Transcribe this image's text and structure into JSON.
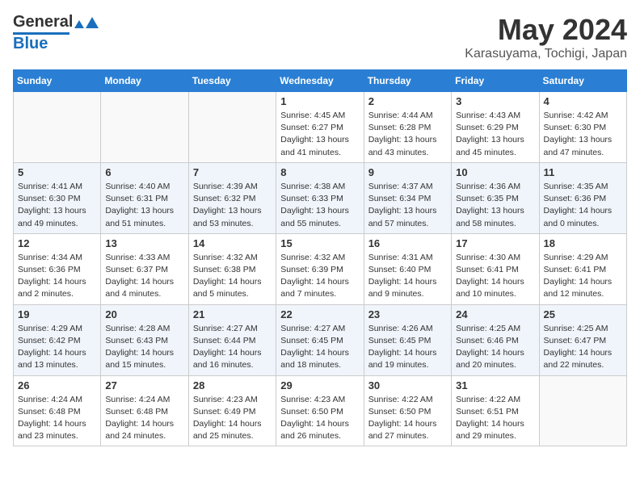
{
  "header": {
    "logo_general": "General",
    "logo_blue": "Blue",
    "month_year": "May 2024",
    "location": "Karasuyama, Tochigi, Japan"
  },
  "days_of_week": [
    "Sunday",
    "Monday",
    "Tuesday",
    "Wednesday",
    "Thursday",
    "Friday",
    "Saturday"
  ],
  "weeks": [
    [
      {
        "day": "",
        "sunrise": "",
        "sunset": "",
        "daylight": ""
      },
      {
        "day": "",
        "sunrise": "",
        "sunset": "",
        "daylight": ""
      },
      {
        "day": "",
        "sunrise": "",
        "sunset": "",
        "daylight": ""
      },
      {
        "day": "1",
        "sunrise": "Sunrise: 4:45 AM",
        "sunset": "Sunset: 6:27 PM",
        "daylight": "Daylight: 13 hours and 41 minutes."
      },
      {
        "day": "2",
        "sunrise": "Sunrise: 4:44 AM",
        "sunset": "Sunset: 6:28 PM",
        "daylight": "Daylight: 13 hours and 43 minutes."
      },
      {
        "day": "3",
        "sunrise": "Sunrise: 4:43 AM",
        "sunset": "Sunset: 6:29 PM",
        "daylight": "Daylight: 13 hours and 45 minutes."
      },
      {
        "day": "4",
        "sunrise": "Sunrise: 4:42 AM",
        "sunset": "Sunset: 6:30 PM",
        "daylight": "Daylight: 13 hours and 47 minutes."
      }
    ],
    [
      {
        "day": "5",
        "sunrise": "Sunrise: 4:41 AM",
        "sunset": "Sunset: 6:30 PM",
        "daylight": "Daylight: 13 hours and 49 minutes."
      },
      {
        "day": "6",
        "sunrise": "Sunrise: 4:40 AM",
        "sunset": "Sunset: 6:31 PM",
        "daylight": "Daylight: 13 hours and 51 minutes."
      },
      {
        "day": "7",
        "sunrise": "Sunrise: 4:39 AM",
        "sunset": "Sunset: 6:32 PM",
        "daylight": "Daylight: 13 hours and 53 minutes."
      },
      {
        "day": "8",
        "sunrise": "Sunrise: 4:38 AM",
        "sunset": "Sunset: 6:33 PM",
        "daylight": "Daylight: 13 hours and 55 minutes."
      },
      {
        "day": "9",
        "sunrise": "Sunrise: 4:37 AM",
        "sunset": "Sunset: 6:34 PM",
        "daylight": "Daylight: 13 hours and 57 minutes."
      },
      {
        "day": "10",
        "sunrise": "Sunrise: 4:36 AM",
        "sunset": "Sunset: 6:35 PM",
        "daylight": "Daylight: 13 hours and 58 minutes."
      },
      {
        "day": "11",
        "sunrise": "Sunrise: 4:35 AM",
        "sunset": "Sunset: 6:36 PM",
        "daylight": "Daylight: 14 hours and 0 minutes."
      }
    ],
    [
      {
        "day": "12",
        "sunrise": "Sunrise: 4:34 AM",
        "sunset": "Sunset: 6:36 PM",
        "daylight": "Daylight: 14 hours and 2 minutes."
      },
      {
        "day": "13",
        "sunrise": "Sunrise: 4:33 AM",
        "sunset": "Sunset: 6:37 PM",
        "daylight": "Daylight: 14 hours and 4 minutes."
      },
      {
        "day": "14",
        "sunrise": "Sunrise: 4:32 AM",
        "sunset": "Sunset: 6:38 PM",
        "daylight": "Daylight: 14 hours and 5 minutes."
      },
      {
        "day": "15",
        "sunrise": "Sunrise: 4:32 AM",
        "sunset": "Sunset: 6:39 PM",
        "daylight": "Daylight: 14 hours and 7 minutes."
      },
      {
        "day": "16",
        "sunrise": "Sunrise: 4:31 AM",
        "sunset": "Sunset: 6:40 PM",
        "daylight": "Daylight: 14 hours and 9 minutes."
      },
      {
        "day": "17",
        "sunrise": "Sunrise: 4:30 AM",
        "sunset": "Sunset: 6:41 PM",
        "daylight": "Daylight: 14 hours and 10 minutes."
      },
      {
        "day": "18",
        "sunrise": "Sunrise: 4:29 AM",
        "sunset": "Sunset: 6:41 PM",
        "daylight": "Daylight: 14 hours and 12 minutes."
      }
    ],
    [
      {
        "day": "19",
        "sunrise": "Sunrise: 4:29 AM",
        "sunset": "Sunset: 6:42 PM",
        "daylight": "Daylight: 14 hours and 13 minutes."
      },
      {
        "day": "20",
        "sunrise": "Sunrise: 4:28 AM",
        "sunset": "Sunset: 6:43 PM",
        "daylight": "Daylight: 14 hours and 15 minutes."
      },
      {
        "day": "21",
        "sunrise": "Sunrise: 4:27 AM",
        "sunset": "Sunset: 6:44 PM",
        "daylight": "Daylight: 14 hours and 16 minutes."
      },
      {
        "day": "22",
        "sunrise": "Sunrise: 4:27 AM",
        "sunset": "Sunset: 6:45 PM",
        "daylight": "Daylight: 14 hours and 18 minutes."
      },
      {
        "day": "23",
        "sunrise": "Sunrise: 4:26 AM",
        "sunset": "Sunset: 6:45 PM",
        "daylight": "Daylight: 14 hours and 19 minutes."
      },
      {
        "day": "24",
        "sunrise": "Sunrise: 4:25 AM",
        "sunset": "Sunset: 6:46 PM",
        "daylight": "Daylight: 14 hours and 20 minutes."
      },
      {
        "day": "25",
        "sunrise": "Sunrise: 4:25 AM",
        "sunset": "Sunset: 6:47 PM",
        "daylight": "Daylight: 14 hours and 22 minutes."
      }
    ],
    [
      {
        "day": "26",
        "sunrise": "Sunrise: 4:24 AM",
        "sunset": "Sunset: 6:48 PM",
        "daylight": "Daylight: 14 hours and 23 minutes."
      },
      {
        "day": "27",
        "sunrise": "Sunrise: 4:24 AM",
        "sunset": "Sunset: 6:48 PM",
        "daylight": "Daylight: 14 hours and 24 minutes."
      },
      {
        "day": "28",
        "sunrise": "Sunrise: 4:23 AM",
        "sunset": "Sunset: 6:49 PM",
        "daylight": "Daylight: 14 hours and 25 minutes."
      },
      {
        "day": "29",
        "sunrise": "Sunrise: 4:23 AM",
        "sunset": "Sunset: 6:50 PM",
        "daylight": "Daylight: 14 hours and 26 minutes."
      },
      {
        "day": "30",
        "sunrise": "Sunrise: 4:22 AM",
        "sunset": "Sunset: 6:50 PM",
        "daylight": "Daylight: 14 hours and 27 minutes."
      },
      {
        "day": "31",
        "sunrise": "Sunrise: 4:22 AM",
        "sunset": "Sunset: 6:51 PM",
        "daylight": "Daylight: 14 hours and 29 minutes."
      },
      {
        "day": "",
        "sunrise": "",
        "sunset": "",
        "daylight": ""
      }
    ]
  ]
}
